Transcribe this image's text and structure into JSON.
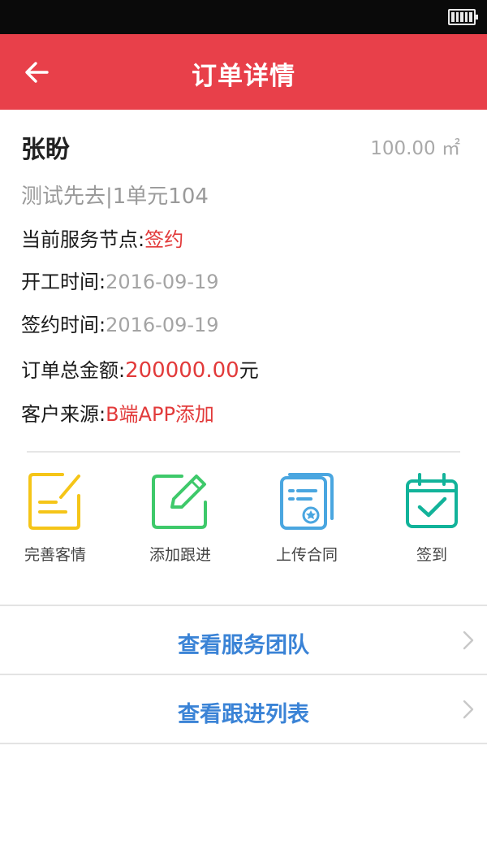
{
  "nav": {
    "title": "订单详情"
  },
  "customer": {
    "name": "张盼",
    "area": "100.00 ㎡",
    "address": "测试先去|1单元104"
  },
  "fields": {
    "service_node": {
      "label": "当前服务节点:",
      "value": "签约"
    },
    "start_time": {
      "label": "开工时间:",
      "value": "2016-09-19"
    },
    "sign_time": {
      "label": "签约时间:",
      "value": "2016-09-19"
    },
    "total_amount": {
      "label": "订单总金额:",
      "value": "200000.00",
      "unit": "元"
    },
    "source": {
      "label": "客户来源:",
      "value": "B端APP添加"
    }
  },
  "actions": [
    {
      "label": "完善客情",
      "icon": "edit-note-icon",
      "color": "#f5c518"
    },
    {
      "label": "添加跟进",
      "icon": "pencil-square-icon",
      "color": "#3ec96a"
    },
    {
      "label": "上传合同",
      "icon": "contract-icon",
      "color": "#4aa6e0"
    },
    {
      "label": "签到",
      "icon": "calendar-check-icon",
      "color": "#12b39a"
    }
  ],
  "links": [
    {
      "label": "查看服务团队"
    },
    {
      "label": "查看跟进列表"
    }
  ],
  "colors": {
    "header": "#e8404a",
    "accent_red": "#e23a3a",
    "link_blue": "#3a83d6"
  }
}
